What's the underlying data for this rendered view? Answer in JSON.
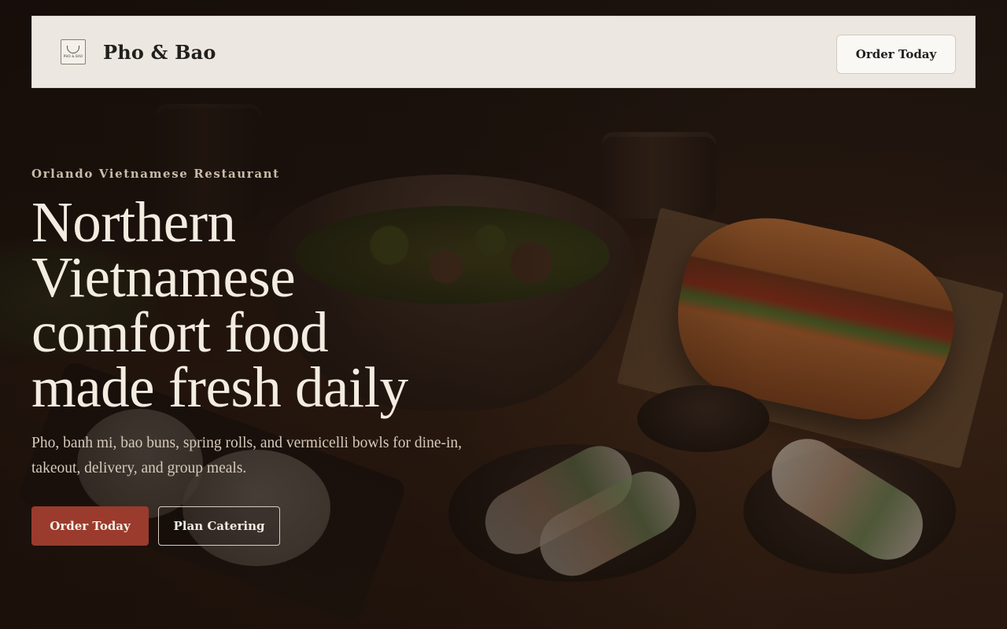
{
  "header": {
    "logo_text": "PHO & BAO",
    "brand_name": "Pho & Bao",
    "cta_label": "Order Today"
  },
  "hero": {
    "eyebrow": "Orlando Vietnamese Restaurant",
    "headline_lines": [
      "Northern",
      "Vietnamese",
      "comfort food",
      "made fresh daily"
    ],
    "subtext": "Pho, banh mi, bao buns, spring rolls, and vermicelli bowls for dine-in, takeout, delivery, and group meals.",
    "primary_cta": "Order Today",
    "secondary_cta": "Plan Catering"
  },
  "colors": {
    "accent": "#9a3b2d",
    "header_bg": "#ece8e1",
    "headline": "#f3ece1"
  }
}
